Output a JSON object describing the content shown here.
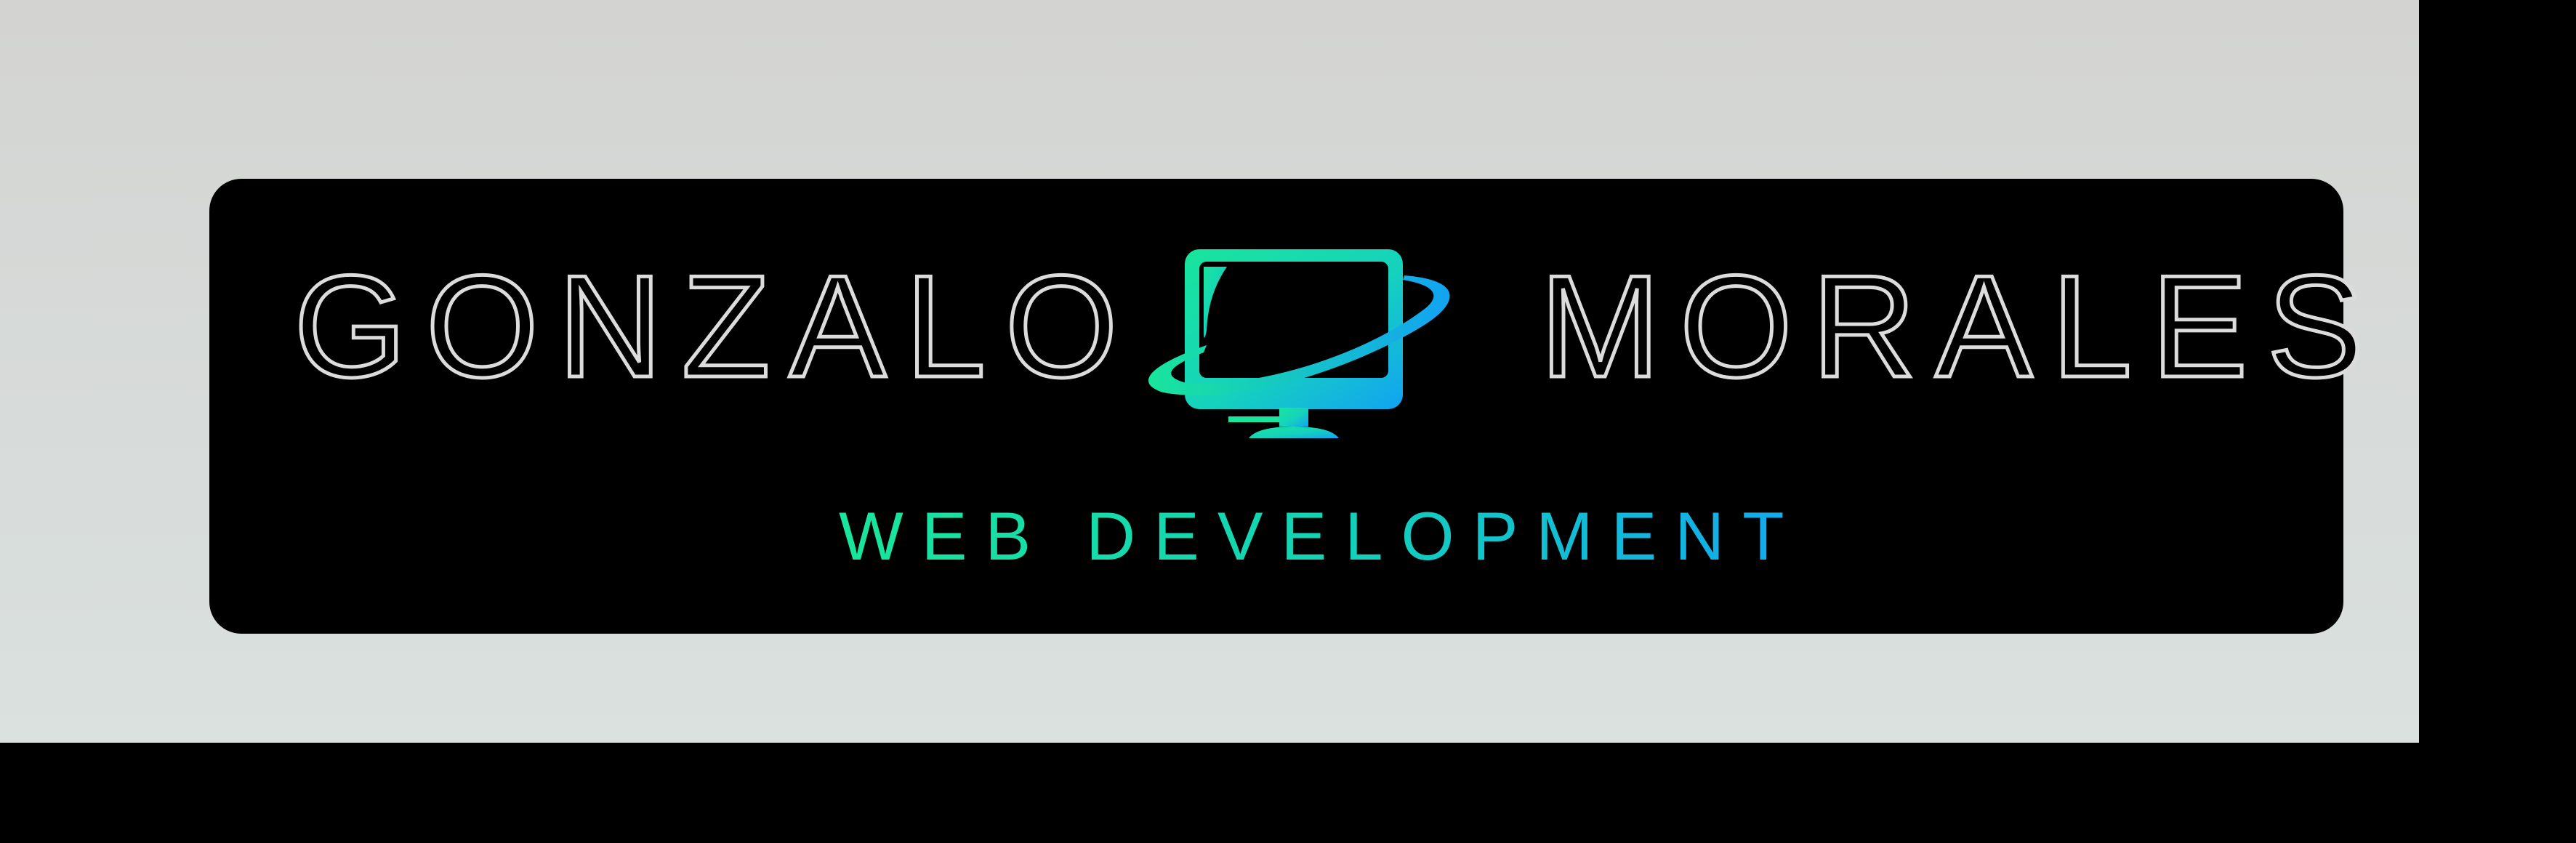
{
  "logo": {
    "first_name": "GONZALO",
    "last_name": "MORALES",
    "tagline": "WEB DEVELOPMENT",
    "icon": "monitor-orbit-icon"
  },
  "colors": {
    "card_background": "#000000",
    "page_background": "#d7dbd9",
    "name_outline": "#dcdcdc",
    "accent_green": "#19e59c",
    "accent_blue": "#12a9f0"
  }
}
